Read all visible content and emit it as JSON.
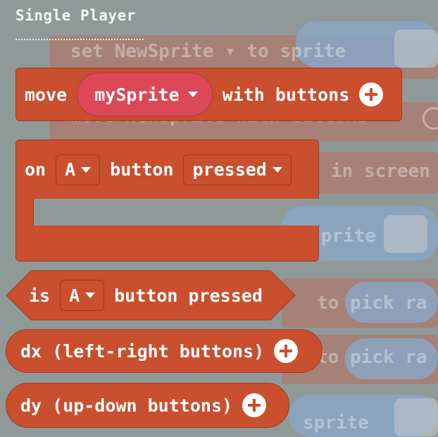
{
  "category": {
    "title": "Single Player"
  },
  "background": {
    "lines": [
      {
        "text": "set  NewSprite ▾  to  sprite"
      },
      {
        "text": "move  NewSprite      with buttons"
      },
      {
        "text": "in screen"
      },
      {
        "text": "sprite"
      },
      {
        "text": "to  pick ra"
      },
      {
        "text": "to  pick ra"
      },
      {
        "text": "sprite"
      }
    ]
  },
  "blocks": {
    "move_with_buttons": {
      "prefix": "move",
      "sprite_value": "mySprite",
      "suffix": "with buttons"
    },
    "on_button": {
      "prefix": "on",
      "button_value": "A",
      "middle": "button",
      "event_value": "pressed"
    },
    "is_pressed": {
      "prefix": "is",
      "button_value": "A",
      "suffix": "button pressed"
    },
    "dx": {
      "label": "dx (left-right buttons)"
    },
    "dy": {
      "label": "dy (up-down buttons)"
    }
  },
  "colors": {
    "block": "#c94f2e",
    "block_border": "#9f3a1f",
    "sprite_pill": "#dc4858",
    "background": "#8f9a98"
  }
}
